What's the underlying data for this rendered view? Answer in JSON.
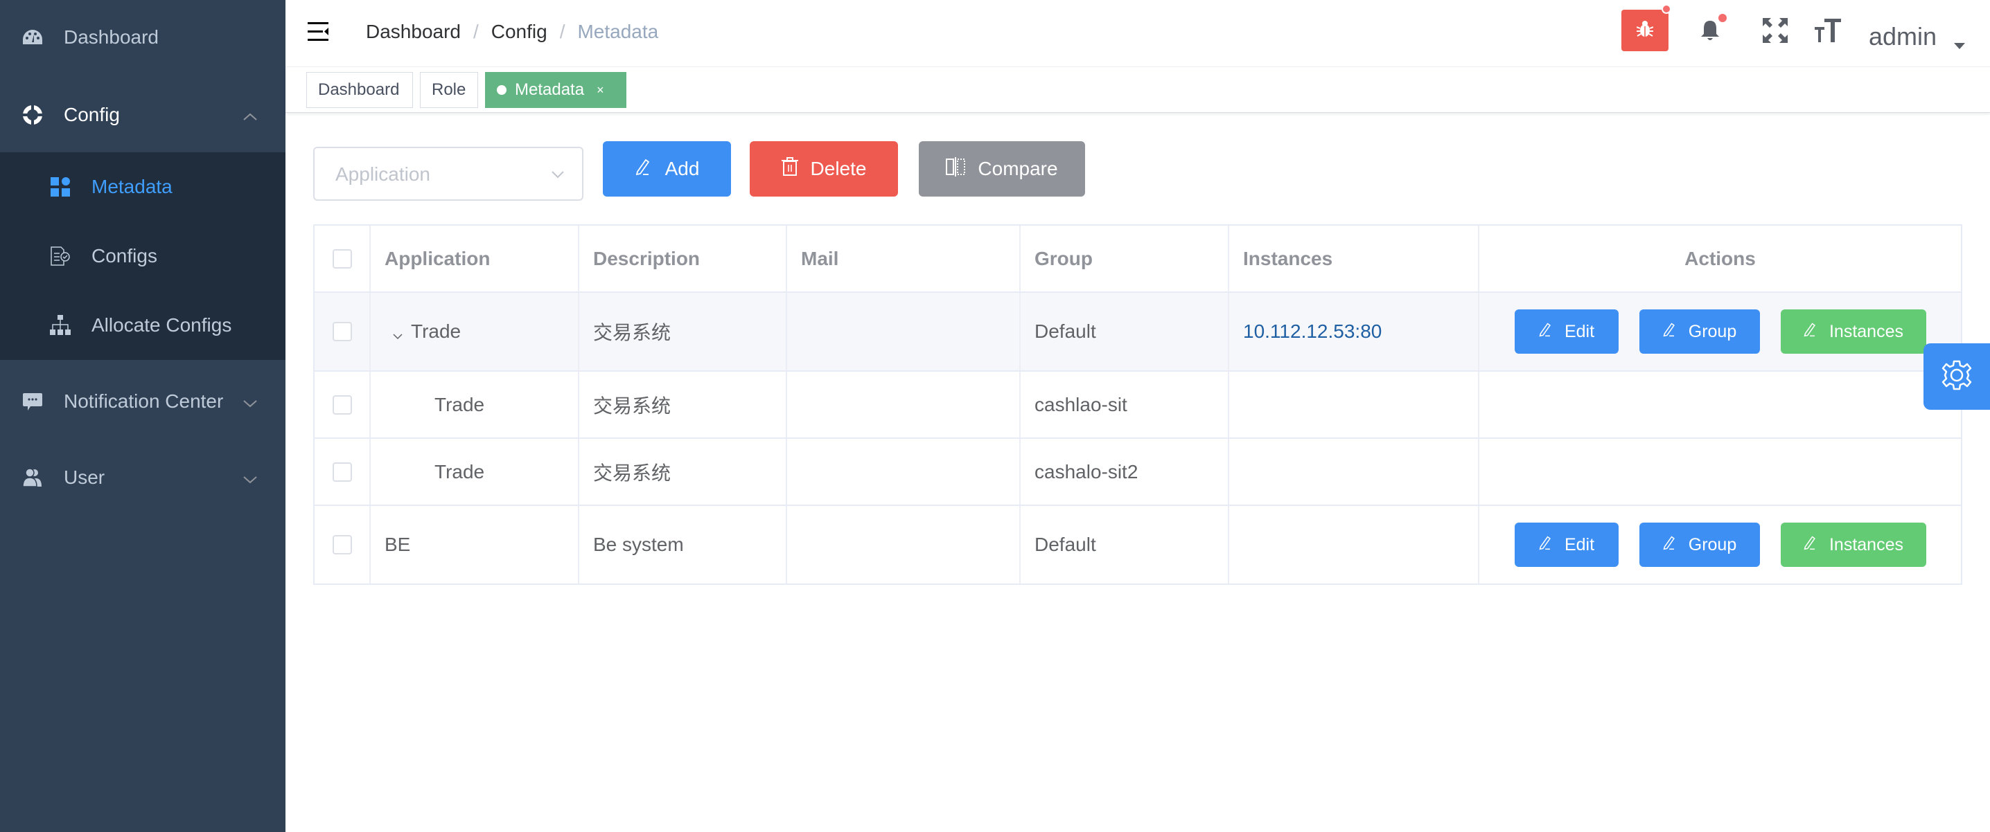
{
  "sidebar": {
    "items": [
      {
        "label": "Dashboard",
        "icon": "dashboard-icon"
      },
      {
        "label": "Config",
        "icon": "config-icon",
        "expanded": true,
        "children": [
          {
            "label": "Metadata",
            "icon": "grid-icon",
            "active": true
          },
          {
            "label": "Configs",
            "icon": "document-check-icon"
          },
          {
            "label": "Allocate Configs",
            "icon": "hierarchy-icon"
          }
        ]
      },
      {
        "label": "Notification Center",
        "icon": "message-icon",
        "expanded": false
      },
      {
        "label": "User",
        "icon": "users-icon",
        "expanded": false
      }
    ]
  },
  "navbar": {
    "breadcrumb": [
      "Dashboard",
      "Config",
      "Metadata"
    ],
    "separator": "/",
    "user": "admin"
  },
  "tags": [
    {
      "label": "Dashboard",
      "active": false
    },
    {
      "label": "Role",
      "active": false
    },
    {
      "label": "Metadata",
      "active": true,
      "close": "×"
    }
  ],
  "toolbar": {
    "application_placeholder": "Application",
    "add_label": "Add",
    "delete_label": "Delete",
    "compare_label": "Compare"
  },
  "table": {
    "columns": [
      "Application",
      "Description",
      "Mail",
      "Group",
      "Instances",
      "Actions"
    ],
    "rows": [
      {
        "application": "Trade",
        "description": "交易系统",
        "mail": "",
        "group": "Default",
        "instances": "10.112.12.53:80",
        "expandable": true,
        "actions": [
          "Edit",
          "Group",
          "Instances"
        ]
      },
      {
        "application": "Trade",
        "description": "交易系统",
        "mail": "",
        "group": "cashlao-sit",
        "instances": "",
        "child": true,
        "actions": []
      },
      {
        "application": "Trade",
        "description": "交易系统",
        "mail": "",
        "group": "cashalo-sit2",
        "instances": "",
        "child": true,
        "actions": []
      },
      {
        "application": "BE",
        "description": "Be system",
        "mail": "",
        "group": "Default",
        "instances": "",
        "actions": [
          "Edit",
          "Group",
          "Instances"
        ]
      }
    ]
  },
  "colors": {
    "sidebar_bg": "#304156",
    "submenu_bg": "#1f2d3d",
    "primary": "#3d8ff3",
    "danger": "#ef5a50",
    "success": "#62cb73",
    "tag_active": "#63b683",
    "info": "#909399"
  }
}
